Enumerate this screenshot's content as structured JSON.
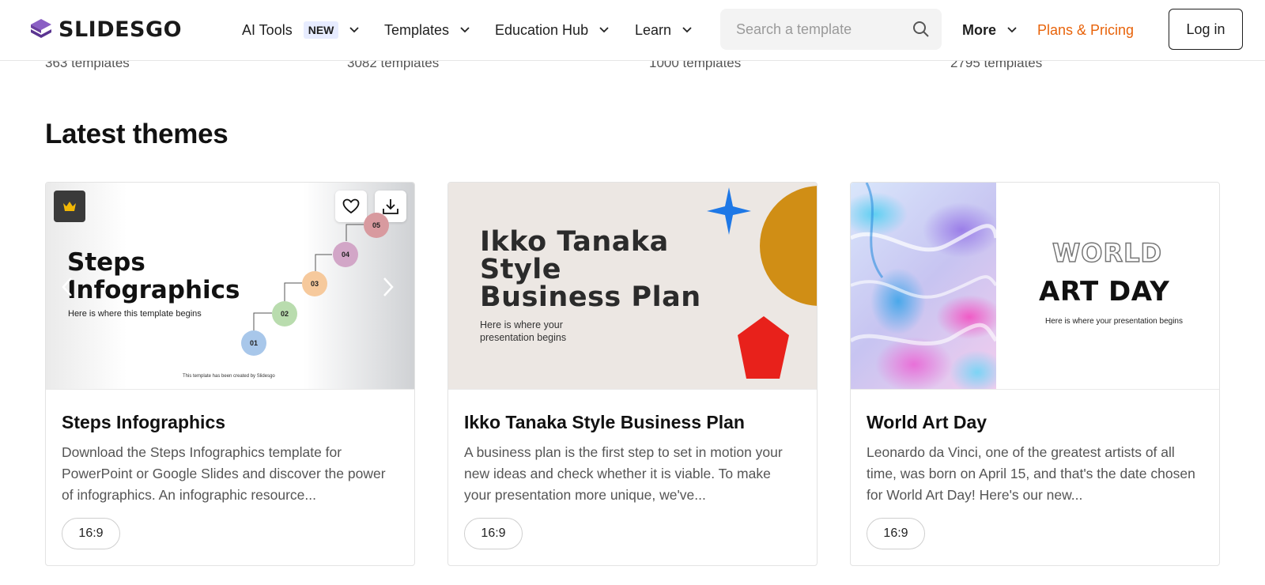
{
  "header": {
    "logo_text": "SLIDESGO",
    "nav": {
      "ai_tools": "AI Tools",
      "ai_tools_badge": "NEW",
      "templates": "Templates",
      "education_hub": "Education Hub",
      "learn": "Learn",
      "more": "More",
      "pricing": "Plans & Pricing"
    },
    "search": {
      "placeholder": "Search a template",
      "value": ""
    },
    "login": "Log in"
  },
  "category_counts": [
    "363 templates",
    "3082 templates",
    "1000 templates",
    "2795 templates"
  ],
  "section_title": "Latest themes",
  "cards": [
    {
      "title": "Steps Infographics",
      "description": "Download the Steps Infographics template for PowerPoint or Google Slides and discover the power of infographics. An infographic resource...",
      "ratio": "16:9",
      "thumb": {
        "heading_line1": "Steps",
        "heading_line2": "Infographics",
        "subtitle": "Here is where this template begins",
        "credit": "This template has been created by Slidesgo",
        "steps": [
          "01",
          "02",
          "03",
          "04",
          "05"
        ]
      }
    },
    {
      "title": "Ikko Tanaka Style Business Plan",
      "description": "A business plan is the first step to set in motion your new ideas and check whether it is viable. To make your presentation more unique, we've...",
      "ratio": "16:9",
      "thumb": {
        "heading_line1": "Ikko Tanaka",
        "heading_line2": "Style",
        "heading_line3": "Business Plan",
        "subtitle_line1": "Here is where your",
        "subtitle_line2": "presentation begins"
      }
    },
    {
      "title": "World Art Day",
      "description": "Leonardo da Vinci, one of the greatest artists of all time, was born on April 15, and that's the date chosen for World Art Day! Here's our new...",
      "ratio": "16:9",
      "thumb": {
        "heading_line1": "WORLD",
        "heading_line2": "ART DAY",
        "subtitle": "Here is where your presentation begins"
      }
    }
  ],
  "colors": {
    "accent_pricing": "#e8630a",
    "logo_purple": "#6b3fa0",
    "premium_crown": "#f2b705"
  }
}
